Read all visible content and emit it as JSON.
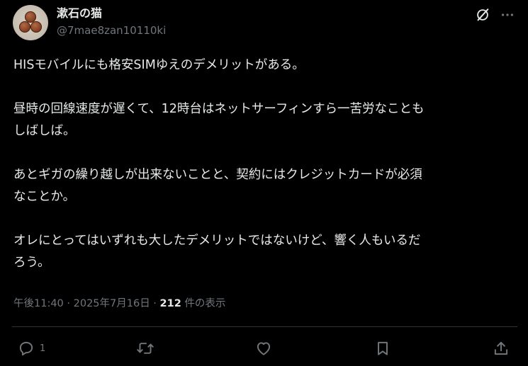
{
  "author": {
    "display_name": "漱石の猫",
    "handle": "@7mae8zan10110ki",
    "avatar_icon": "coins-avatar"
  },
  "header_actions": {
    "grok_icon": "grok-icon",
    "more_icon": "more-dots-icon"
  },
  "tweet": {
    "lines": [
      "HISモバイルにも格安SIMゆえのデメリットがある。",
      "昼時の回線速度が遅くて、12時台はネットサーフィンすら一苦労なことも",
      "しばしば。",
      "あとギガの繰り越しが出来ないことと、契約にはクレジットカードが必須",
      "なことか。",
      "オレにとってはいずれも大したデメリットではないけど、響く人もいるだ",
      "ろう。"
    ]
  },
  "meta": {
    "time": "午後11:40",
    "sep1": " · ",
    "date": "2025年7月16日",
    "sep2": " · ",
    "views_count": "212",
    "views_label": " 件の表示"
  },
  "actions": {
    "reply_count": "1",
    "retweet_count": "",
    "like_count": "",
    "icons": [
      "reply-icon",
      "retweet-icon",
      "like-icon",
      "bookmark-icon",
      "share-icon"
    ]
  },
  "colors": {
    "background": "#000000",
    "text_primary": "#e7e9ea",
    "text_secondary": "#71767b",
    "divider": "#2f3336"
  }
}
